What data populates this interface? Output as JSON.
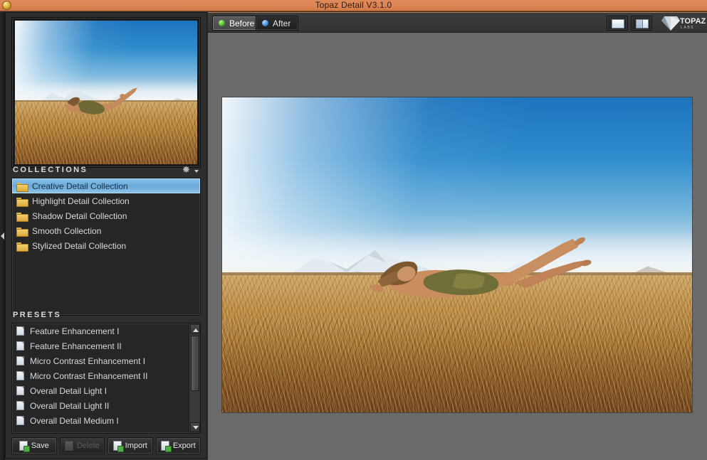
{
  "window": {
    "title": "Topaz Detail V3.1.0",
    "icon": "app-icon",
    "titlebar_color": "#dd8454"
  },
  "left_panel": {
    "preview": {
      "name": "image-thumbnail",
      "alt": "Woman levitating over golden field with snowy mountains"
    },
    "collections": {
      "header": "COLLECTIONS",
      "settings_icon": "gear-icon",
      "caret_icon": "chevron-down-icon",
      "items": [
        {
          "label": "Creative Detail Collection",
          "icon": "folder-icon",
          "selected": true
        },
        {
          "label": "Highlight Detail Collection",
          "icon": "folder-icon",
          "selected": false
        },
        {
          "label": "Shadow Detail Collection",
          "icon": "folder-icon",
          "selected": false
        },
        {
          "label": "Smooth Collection",
          "icon": "folder-icon",
          "selected": false
        },
        {
          "label": "Stylized Detail Collection",
          "icon": "folder-icon",
          "selected": false
        }
      ]
    },
    "presets": {
      "header": "PRESETS",
      "items": [
        {
          "label": "Feature Enhancement I",
          "icon": "document-icon"
        },
        {
          "label": "Feature Enhancement II",
          "icon": "document-icon"
        },
        {
          "label": "Micro Contrast Enhancement I",
          "icon": "document-icon"
        },
        {
          "label": "Micro Contrast Enhancement II",
          "icon": "document-icon"
        },
        {
          "label": "Overall Detail Light I",
          "icon": "document-icon"
        },
        {
          "label": "Overall Detail Light II",
          "icon": "document-icon"
        },
        {
          "label": "Overall Detail Medium I",
          "icon": "document-icon"
        }
      ],
      "scrollbar": {
        "up_icon": "arrow-up-icon",
        "down_icon": "arrow-down-icon"
      }
    },
    "buttons": [
      {
        "label": "Save",
        "icon": "save-icon",
        "disabled": false
      },
      {
        "label": "Delete",
        "icon": "delete-icon",
        "disabled": true
      },
      {
        "label": "Import",
        "icon": "import-icon",
        "disabled": false
      },
      {
        "label": "Export",
        "icon": "export-icon",
        "disabled": false
      }
    ],
    "collapse_icon": "collapse-panel-arrow-icon"
  },
  "main": {
    "tabs": [
      {
        "label": "Before",
        "dot": "green",
        "active": true
      },
      {
        "label": "After",
        "dot": "blue",
        "active": false
      }
    ],
    "view_buttons": [
      {
        "name": "single-view-button",
        "icon": "single-pane-icon"
      },
      {
        "name": "split-view-button",
        "icon": "split-pane-icon"
      }
    ],
    "brand_logo": "topaz-logo",
    "image": {
      "name": "main-preview-image",
      "alt": "Woman levitating over golden field with snowy mountains"
    }
  }
}
